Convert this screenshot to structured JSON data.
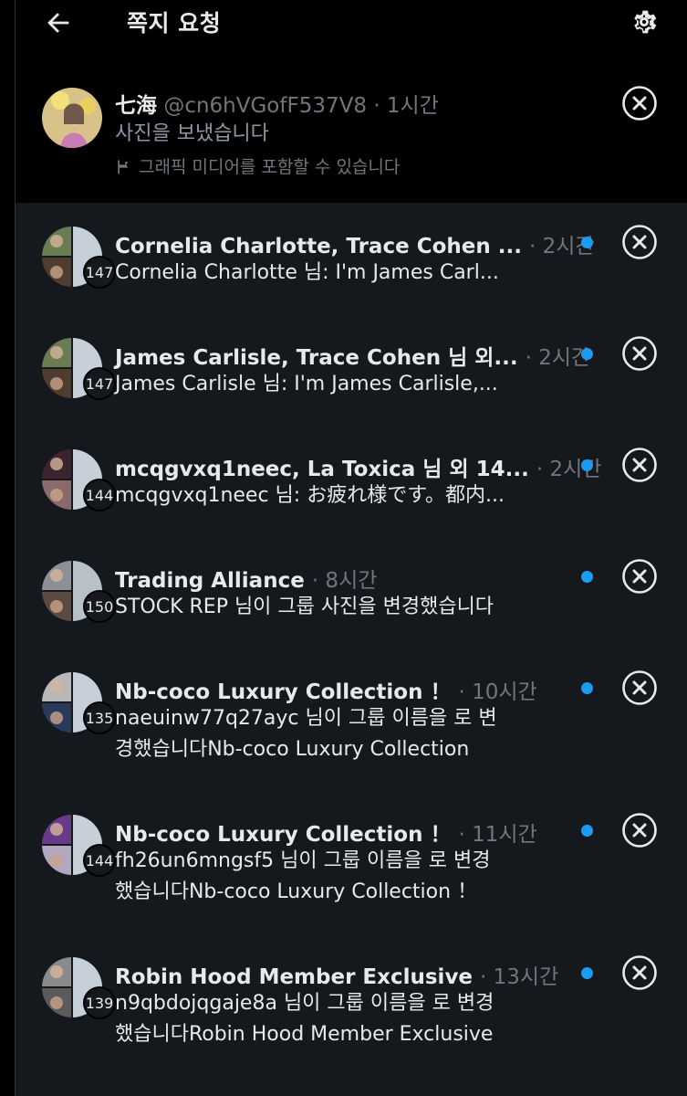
{
  "header": {
    "title": "쪽지 요청"
  },
  "first_item": {
    "name": "七海",
    "handle": "@cn6hVGofF537V8",
    "time": "· 1시간",
    "message": "사진을 보냈습니다",
    "note": "그래픽 미디어를 포함할 수 있습니다"
  },
  "items": [
    {
      "title": "Cornelia Charlotte, Trace Cohen ...",
      "time": "· 2시간",
      "count": "147",
      "lines": [
        "Cornelia Charlotte 님: I'm James Carl..."
      ],
      "unread": true
    },
    {
      "title": "James Carlisle, Trace Cohen 님 외...",
      "time": "· 2시간",
      "count": "147",
      "lines": [
        "James Carlisle 님: I'm James Carlisle,..."
      ],
      "unread": true
    },
    {
      "title": "mcqgvxq1neec, La Toxica 님 외 14...",
      "time": "· 2시간",
      "count": "144",
      "lines": [
        "mcqgvxq1neec 님: お疲れ様です。都内..."
      ],
      "unread": true
    },
    {
      "title": "Trading Alliance",
      "time": "· 8시간",
      "count": "150",
      "lines": [
        "STOCK REP 님이 그룹 사진을 변경했습니다"
      ],
      "unread": true
    },
    {
      "title": "Nb-coco Luxury Collection ！",
      "time": "· 10시간",
      "count": "135",
      "lines": [
        "naeuinw77q27ayc 님이 그룹 이름을 로 변",
        "경했습니다Nb-coco Luxury Collection"
      ],
      "unread": true
    },
    {
      "title": "Nb-coco Luxury Collection ！",
      "time": "· 11시간",
      "count": "144",
      "lines": [
        "fh26un6mngsf5 님이 그룹 이름을 로 변경",
        "했습니다Nb-coco Luxury Collection ！"
      ],
      "unread": true
    },
    {
      "title": "Robin Hood Member Exclusive",
      "time": "· 13시간",
      "count": "139",
      "lines": [
        "n9qbdojqgaje8a 님이 그룹 이름을 로 변경",
        "했습니다Robin Hood Member Exclusive"
      ],
      "unread": true
    }
  ],
  "icons": {
    "back": "back-arrow-icon",
    "settings": "gear-icon",
    "close": "close-circle-icon",
    "flag": "flag-icon"
  },
  "colors": {
    "accent": "#1d9bf0",
    "background": "#000000",
    "list_bg": "#15181d",
    "muted": "#71767b"
  }
}
